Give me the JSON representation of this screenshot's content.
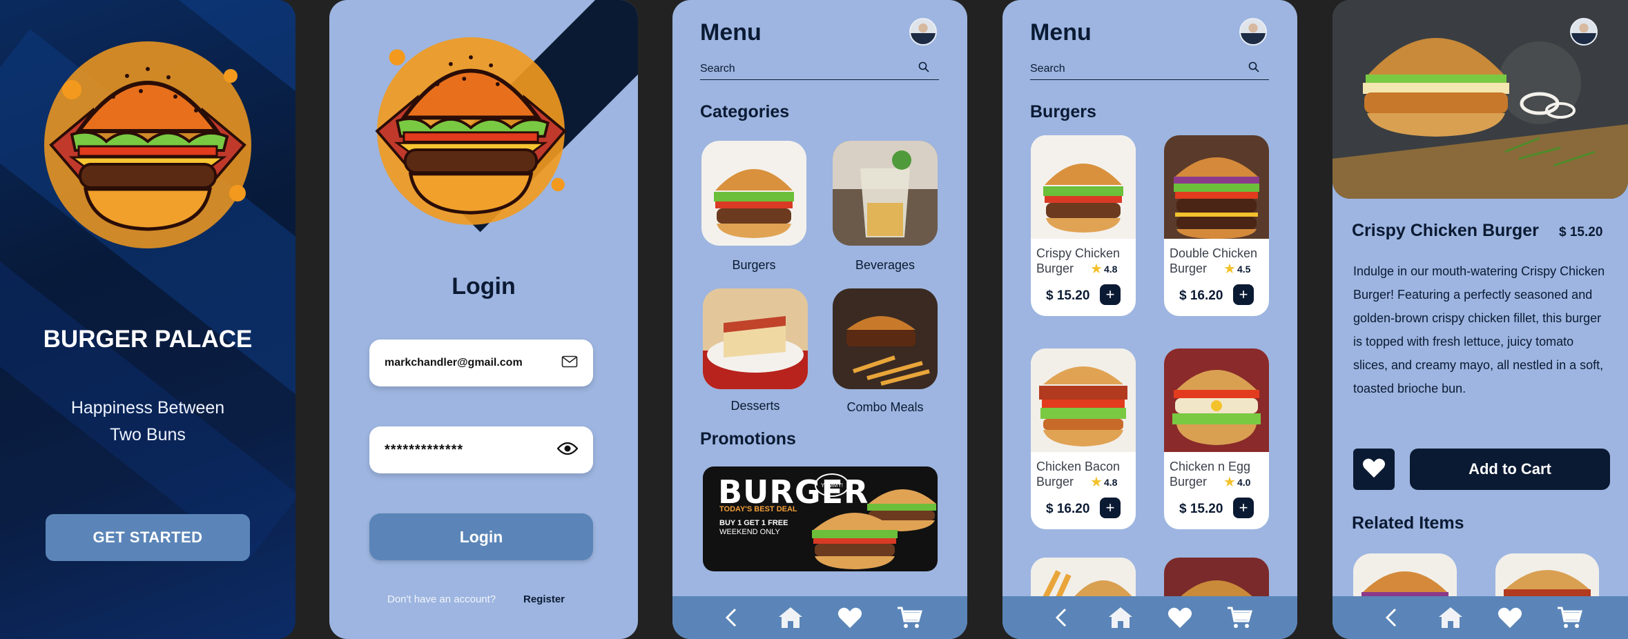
{
  "colors": {
    "navy": "#0b1a33",
    "accent": "#5b85b8",
    "surface": "#9db5e0",
    "burger_orange": "#f39a1e"
  },
  "splash": {
    "title": "BURGER PALACE",
    "tagline": "Happiness Between Two Buns",
    "cta": "GET STARTED"
  },
  "login": {
    "title": "Login",
    "email_value": "markchandler@gmail.com",
    "password_value": "*************",
    "button": "Login",
    "no_account": "Don't have an account?",
    "register": "Register"
  },
  "menu": {
    "title": "Menu",
    "search_placeholder": "Search",
    "categories_heading": "Categories",
    "categories": [
      {
        "label": "Burgers",
        "icon": "burger-image"
      },
      {
        "label": "Beverages",
        "icon": "beverage-image"
      },
      {
        "label": "Desserts",
        "icon": "dessert-image"
      },
      {
        "label": "Combo Meals",
        "icon": "combo-image"
      }
    ],
    "promotions_heading": "Promotions",
    "promo": {
      "title": "BURGER",
      "subtitle": "TODAY'S BEST DEAL",
      "deal": "BUY 1 GET 1 FREE",
      "when": "WEEKEND ONLY",
      "badge": "YUMMY!"
    }
  },
  "burgers": {
    "title": "Menu",
    "search_placeholder": "Search",
    "heading": "Burgers",
    "items": [
      {
        "name": "Crispy Chicken Burger",
        "rating": "4.8",
        "price": "$ 15.20"
      },
      {
        "name": "Double Chicken Burger",
        "rating": "4.5",
        "price": "$ 16.20"
      },
      {
        "name": "Chicken Bacon Burger",
        "rating": "4.8",
        "price": "$ 16.20"
      },
      {
        "name": "Chicken n Egg Burger",
        "rating": "4.0",
        "price": "$ 15.20"
      }
    ]
  },
  "detail": {
    "name": "Crispy Chicken Burger",
    "price": "$ 15.20",
    "description": "Indulge in our mouth-watering Crispy Chicken Burger! Featuring a perfectly seasoned and golden-brown crispy chicken fillet, this burger is topped with fresh lettuce, juicy tomato slices, and creamy mayo, all nestled in a soft, toasted brioche bun.",
    "add_to_cart": "Add to Cart",
    "related_heading": "Related Items"
  },
  "nav": [
    "back-icon",
    "home-icon",
    "heart-icon",
    "cart-icon"
  ]
}
